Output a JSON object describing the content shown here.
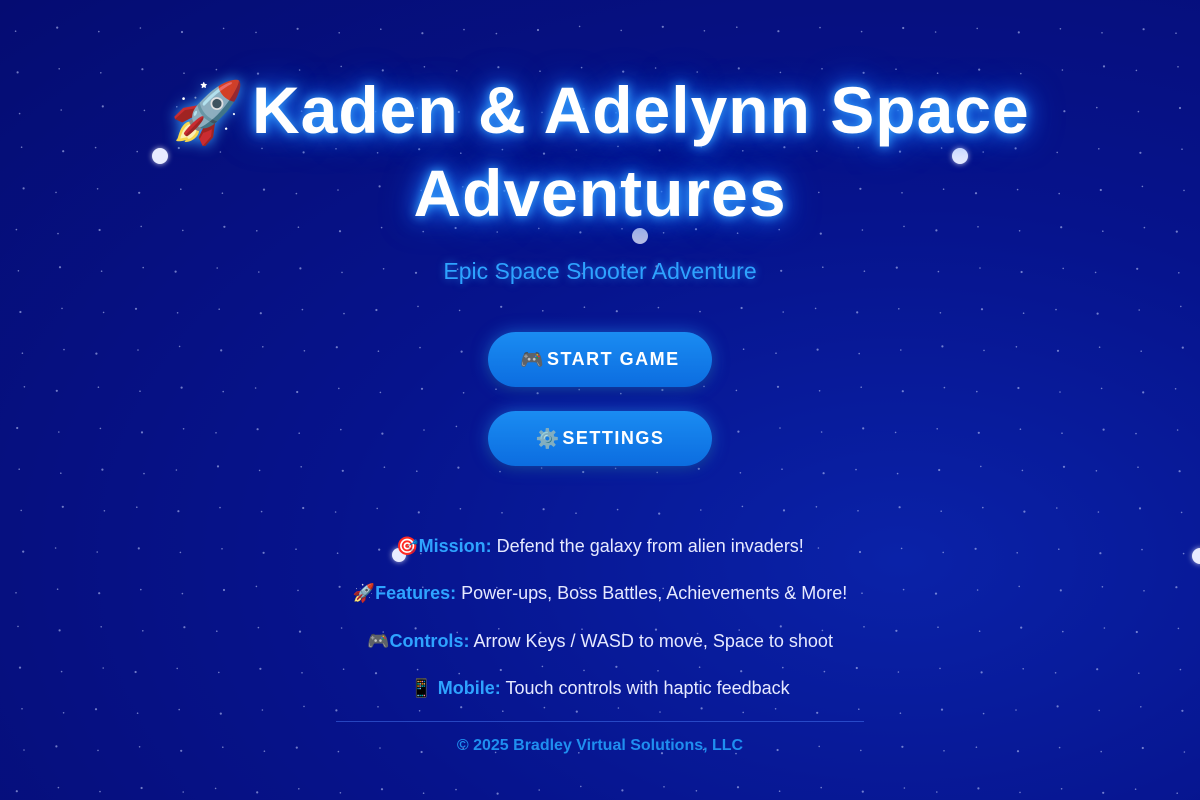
{
  "title": {
    "icon": "rocket-icon",
    "icon_glyph": "🚀",
    "text": "Kaden & Adelynn Space Adventures"
  },
  "subtitle": "Epic Space Shooter Adventure",
  "buttons": {
    "start": {
      "icon": "gamepad-icon",
      "icon_glyph": "🎮",
      "label": "START GAME"
    },
    "settings": {
      "icon": "gear-icon",
      "icon_glyph": "⚙️",
      "label": "SETTINGS"
    }
  },
  "info": {
    "mission": {
      "icon": "target-icon",
      "icon_glyph": "🎯",
      "label": "Mission:",
      "text": "Defend the galaxy from alien invaders!"
    },
    "features": {
      "icon": "rocket-icon",
      "icon_glyph": "🚀",
      "label": "Features:",
      "text": "Power-ups, Boss Battles, Achievements & More!"
    },
    "controls": {
      "icon": "gamepad-icon",
      "icon_glyph": "🎮",
      "label": "Controls:",
      "text": "Arrow Keys / WASD to move, Space to shoot"
    },
    "mobile": {
      "icon": "phone-icon",
      "icon_glyph": "📱",
      "label": "Mobile:",
      "text": "Touch controls with haptic feedback"
    }
  },
  "footer": "© 2025 Bradley Virtual Solutions, LLC",
  "colors": {
    "background": "#06138c",
    "accent": "#2ea3ff",
    "button": "#1a8cf2",
    "title_glow": "#1e7dff"
  }
}
